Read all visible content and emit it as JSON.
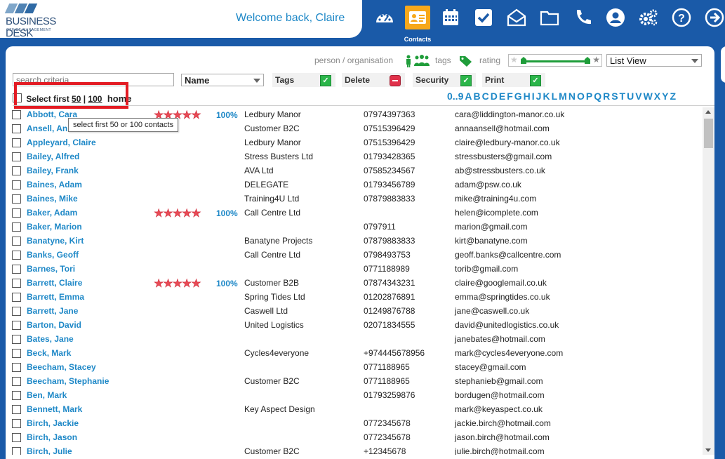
{
  "header": {
    "logo_name": "BUSINESS DESK",
    "logo_sub": "OFFICE MANAGEMENT",
    "welcome": "Welcome back, Claire",
    "active_nav_label": "Contacts",
    "nav_icons": [
      "dashboard-icon",
      "contacts-icon",
      "calendar-icon",
      "tasks-check-icon",
      "mail-icon",
      "folder-icon",
      "phone-icon",
      "user-profile-icon",
      "settings-icon",
      "help-icon",
      "logout-arrow-icon"
    ]
  },
  "filters": {
    "person_org_label": "person / organisation",
    "tags_label": "tags",
    "rating_label": "rating",
    "view_select": "List View",
    "search_placeholder": "search criteria",
    "name_select": "Name",
    "tags_toggle": "Tags",
    "delete_toggle": "Delete",
    "security_toggle": "Security",
    "print_toggle": "Print"
  },
  "selection": {
    "prefix": "Select first",
    "opt50": "50",
    "sep": "|",
    "opt100": "100",
    "home": "home",
    "tooltip": "select first 50 or 100 contacts"
  },
  "alphabet": [
    "0..9",
    "A",
    "B",
    "C",
    "D",
    "E",
    "F",
    "G",
    "H",
    "I",
    "J",
    "K",
    "L",
    "M",
    "N",
    "O",
    "P",
    "Q",
    "R",
    "S",
    "T",
    "U",
    "V",
    "W",
    "X",
    "Y",
    "Z"
  ],
  "contacts": [
    {
      "name": "Abbott, Cara",
      "rating": "100%",
      "company": "Ledbury Manor",
      "phone": "07974397363",
      "email": "cara@liddington-manor.co.uk"
    },
    {
      "name": "Ansell, Anna",
      "rating": "",
      "company": "Customer B2C",
      "phone": "07515396429",
      "email": "annaansell@hotmail.com"
    },
    {
      "name": "Appleyard, Claire",
      "rating": "",
      "company": "Ledbury Manor",
      "phone": "07515396429",
      "email": "claire@ledbury-manor.co.uk"
    },
    {
      "name": "Bailey, Alfred",
      "rating": "",
      "company": "Stress Busters Ltd",
      "phone": "01793428365",
      "email": "stressbusters@gmail.com"
    },
    {
      "name": "Bailey, Frank",
      "rating": "",
      "company": "AVA Ltd",
      "phone": "07585234567",
      "email": "ab@stressbusters.co.uk"
    },
    {
      "name": "Baines, Adam",
      "rating": "",
      "company": "DELEGATE",
      "phone": "01793456789",
      "email": "adam@psw.co.uk"
    },
    {
      "name": "Baines, Mike",
      "rating": "",
      "company": "Training4U Ltd",
      "phone": "07879883833",
      "email": "mike@training4u.com"
    },
    {
      "name": "Baker, Adam",
      "rating": "100%",
      "company": "Call Centre Ltd",
      "phone": "",
      "email": "helen@icomplete.com"
    },
    {
      "name": "Baker, Marion",
      "rating": "",
      "company": "",
      "phone": "0797911",
      "email": "marion@gmail.com"
    },
    {
      "name": "Banatyne, Kirt",
      "rating": "",
      "company": "Banatyne Projects",
      "phone": "07879883833",
      "email": "kirt@banatyne.com"
    },
    {
      "name": "Banks, Geoff",
      "rating": "",
      "company": "Call Centre Ltd",
      "phone": "0798493753",
      "email": "geoff.banks@callcentre.com"
    },
    {
      "name": "Barnes, Tori",
      "rating": "",
      "company": "",
      "phone": "0771188989",
      "email": "torib@gmail.com"
    },
    {
      "name": "Barrett, Claire",
      "rating": "100%",
      "company": "Customer B2B",
      "phone": "07874343231",
      "email": "claire@googlemail.co.uk"
    },
    {
      "name": "Barrett, Emma",
      "rating": "",
      "company": "Spring Tides Ltd",
      "phone": "01202876891",
      "email": "emma@springtides.co.uk"
    },
    {
      "name": "Barrett, Jane",
      "rating": "",
      "company": "Caswell Ltd",
      "phone": "01249876788",
      "email": "jane@caswell.co.uk"
    },
    {
      "name": "Barton, David",
      "rating": "",
      "company": "United Logistics",
      "phone": "02071834555",
      "email": "david@unitedlogistics.co.uk"
    },
    {
      "name": "Bates, Jane",
      "rating": "",
      "company": "",
      "phone": "",
      "email": "janebates@hotmail.com"
    },
    {
      "name": "Beck, Mark",
      "rating": "",
      "company": "Cycles4everyone",
      "phone": "+974445678956",
      "email": "mark@cycles4everyone.com"
    },
    {
      "name": "Beecham, Stacey",
      "rating": "",
      "company": "",
      "phone": "0771188965",
      "email": "stacey@gmail.com"
    },
    {
      "name": "Beecham, Stephanie",
      "rating": "",
      "company": "Customer B2C",
      "phone": "0771188965",
      "email": "stephanieb@gmail.com"
    },
    {
      "name": "Ben, Mark",
      "rating": "",
      "company": "",
      "phone": "01793259876",
      "email": "bordugen@hotmail.com"
    },
    {
      "name": "Bennett, Mark",
      "rating": "",
      "company": "Key Aspect Design",
      "phone": "",
      "email": "mark@keyaspect.co.uk"
    },
    {
      "name": "Birch, Jackie",
      "rating": "",
      "company": "",
      "phone": "0772345678",
      "email": "jackie.birch@hotmail.com"
    },
    {
      "name": "Birch, Jason",
      "rating": "",
      "company": "",
      "phone": "0772345678",
      "email": "jason.birch@hotmail.com"
    },
    {
      "name": "Birch, Julie",
      "rating": "",
      "company": "Customer B2C",
      "phone": "+12345678",
      "email": "julie.birch@hotmail.com"
    }
  ],
  "colors": {
    "brand_blue": "#1a5aa8",
    "link_blue": "#1e88c7",
    "active_orange": "#f7a81b",
    "highlight_red": "#e31b23"
  }
}
